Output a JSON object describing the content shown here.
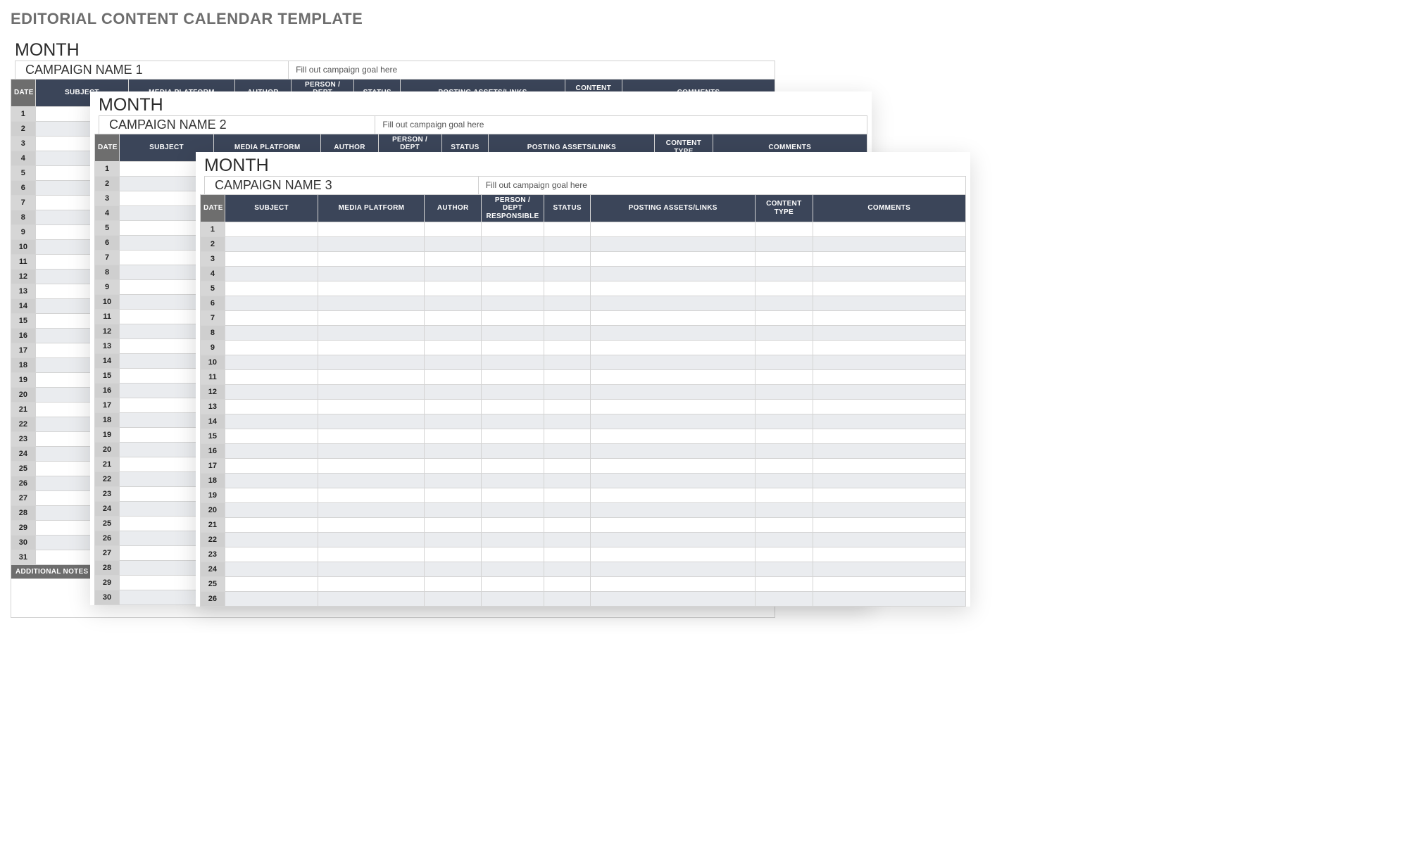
{
  "doc_title": "EDITORIAL CONTENT CALENDAR TEMPLATE",
  "columns": {
    "date": "DATE",
    "subject": "SUBJECT",
    "media": "MEDIA PLATFORM",
    "author": "AUTHOR",
    "dept": "PERSON / DEPT RESPONSIBLE",
    "status": "STATUS",
    "assets": "POSTING ASSETS/LINKS",
    "ctype": "CONTENT TYPE",
    "comments": "COMMENTS"
  },
  "footer_label": "ADDITIONAL NOTES FOR CAMPAIGN",
  "sheets": [
    {
      "month_label": "MONTH",
      "campaign_name": "CAMPAIGN NAME 1",
      "campaign_goal_placeholder": "Fill out campaign goal here",
      "row_count": 31,
      "show_footer": true
    },
    {
      "month_label": "MONTH",
      "campaign_name": "CAMPAIGN NAME 2",
      "campaign_goal_placeholder": "Fill out campaign goal here",
      "row_count": 30,
      "show_footer": false
    },
    {
      "month_label": "MONTH",
      "campaign_name": "CAMPAIGN NAME 3",
      "campaign_goal_placeholder": "Fill out campaign goal here",
      "row_count": 26,
      "show_footer": false
    }
  ]
}
